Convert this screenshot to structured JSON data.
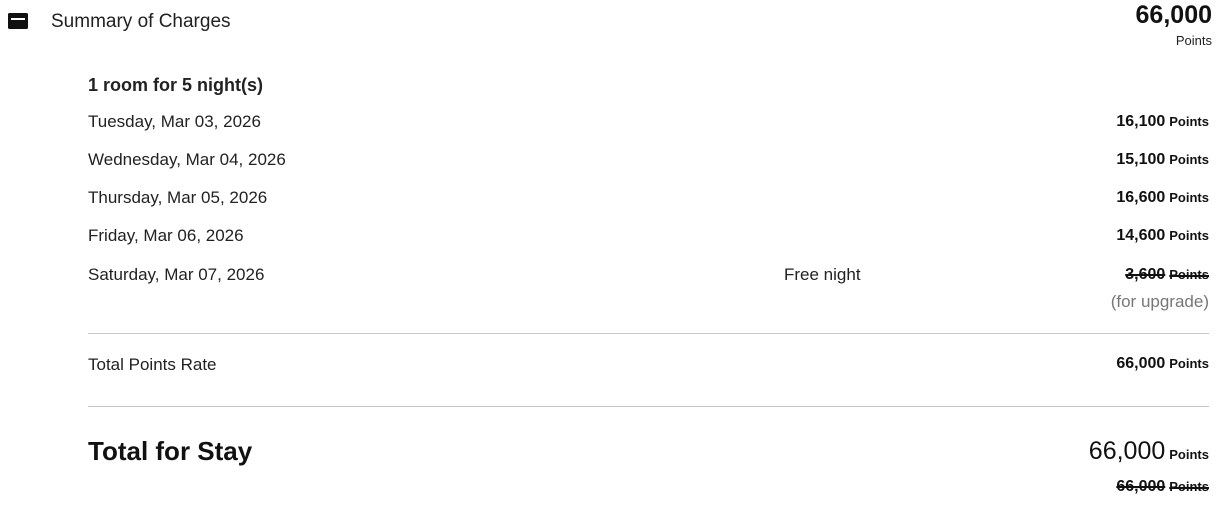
{
  "header": {
    "title": "Summary of Charges",
    "icon": "card-icon",
    "total_points": "66,000",
    "total_unit": "Points"
  },
  "rooms": {
    "heading": "1 room for 5 night(s)"
  },
  "nights": [
    {
      "date": "Tuesday, Mar 03, 2026",
      "note": "",
      "points": "16,100",
      "unit": "Points",
      "struck": false
    },
    {
      "date": "Wednesday, Mar 04, 2026",
      "note": "",
      "points": "15,100",
      "unit": "Points",
      "struck": false
    },
    {
      "date": "Thursday, Mar 05, 2026",
      "note": "",
      "points": "16,600",
      "unit": "Points",
      "struck": false
    },
    {
      "date": "Friday, Mar 06, 2026",
      "note": "",
      "points": "14,600",
      "unit": "Points",
      "struck": false
    },
    {
      "date": "Saturday, Mar 07, 2026",
      "note": "Free night",
      "points": "3,600",
      "unit": "Points",
      "struck": true
    }
  ],
  "upgrade_note": "(for upgrade)",
  "points_rate": {
    "label": "Total Points Rate",
    "points": "66,000",
    "unit": "Points"
  },
  "stay": {
    "label": "Total for Stay",
    "points": "66,000",
    "unit": "Points",
    "original_points": "66,000",
    "original_unit": "Points"
  }
}
